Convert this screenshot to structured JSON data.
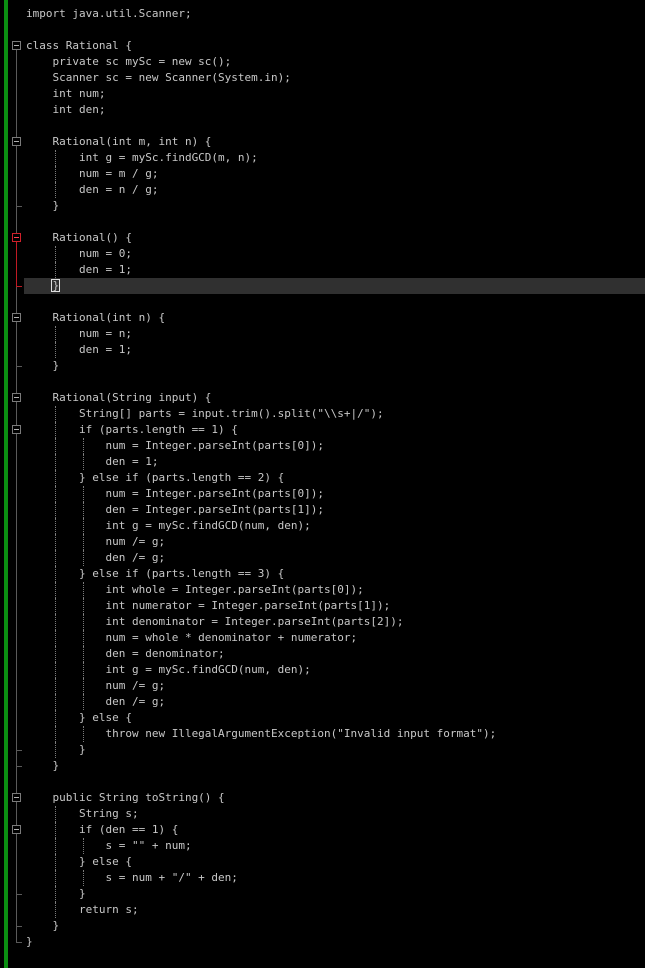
{
  "editor": {
    "language": "java",
    "colors": {
      "background": "#000000",
      "text": "#c8c8c8",
      "current_line": "#303030",
      "change_bar": "#0b8f12",
      "fold_active": "#d0202a"
    },
    "current_line_index": 17,
    "lines": [
      "import java.util.Scanner;",
      "",
      "class Rational {",
      "    private sc mySc = new sc();",
      "    Scanner sc = new Scanner(System.in);",
      "    int num;",
      "    int den;",
      "",
      "    Rational(int m, int n) {",
      "        int g = mySc.findGCD(m, n);",
      "        num = m / g;",
      "        den = n / g;",
      "    }",
      "",
      "    Rational() {",
      "        num = 0;",
      "        den = 1;",
      "    }",
      "",
      "    Rational(int n) {",
      "        num = n;",
      "        den = 1;",
      "    }",
      "",
      "    Rational(String input) {",
      "        String[] parts = input.trim().split(\"\\\\s+|/\");",
      "        if (parts.length == 1) {",
      "            num = Integer.parseInt(parts[0]);",
      "            den = 1;",
      "        } else if (parts.length == 2) {",
      "            num = Integer.parseInt(parts[0]);",
      "            den = Integer.parseInt(parts[1]);",
      "            int g = mySc.findGCD(num, den);",
      "            num /= g;",
      "            den /= g;",
      "        } else if (parts.length == 3) {",
      "            int whole = Integer.parseInt(parts[0]);",
      "            int numerator = Integer.parseInt(parts[1]);",
      "            int denominator = Integer.parseInt(parts[2]);",
      "            num = whole * denominator + numerator;",
      "            den = denominator;",
      "            int g = mySc.findGCD(num, den);",
      "            num /= g;",
      "            den /= g;",
      "        } else {",
      "            throw new IllegalArgumentException(\"Invalid input format\");",
      "        }",
      "    }",
      "",
      "    public String toString() {",
      "        String s;",
      "        if (den == 1) {",
      "            s = \"\" + num;",
      "        } else {",
      "            s = num + \"/\" + den;",
      "        }",
      "        return s;",
      "    }",
      "}"
    ],
    "folds": [
      {
        "start": 2,
        "end": 58,
        "active": false
      },
      {
        "start": 8,
        "end": 12,
        "active": false
      },
      {
        "start": 14,
        "end": 17,
        "active": true
      },
      {
        "start": 19,
        "end": 22,
        "active": false
      },
      {
        "start": 24,
        "end": 47,
        "active": false
      },
      {
        "start": 26,
        "end": 46,
        "active": false
      },
      {
        "start": 49,
        "end": 57,
        "active": false
      },
      {
        "start": 51,
        "end": 55,
        "active": false
      }
    ]
  }
}
